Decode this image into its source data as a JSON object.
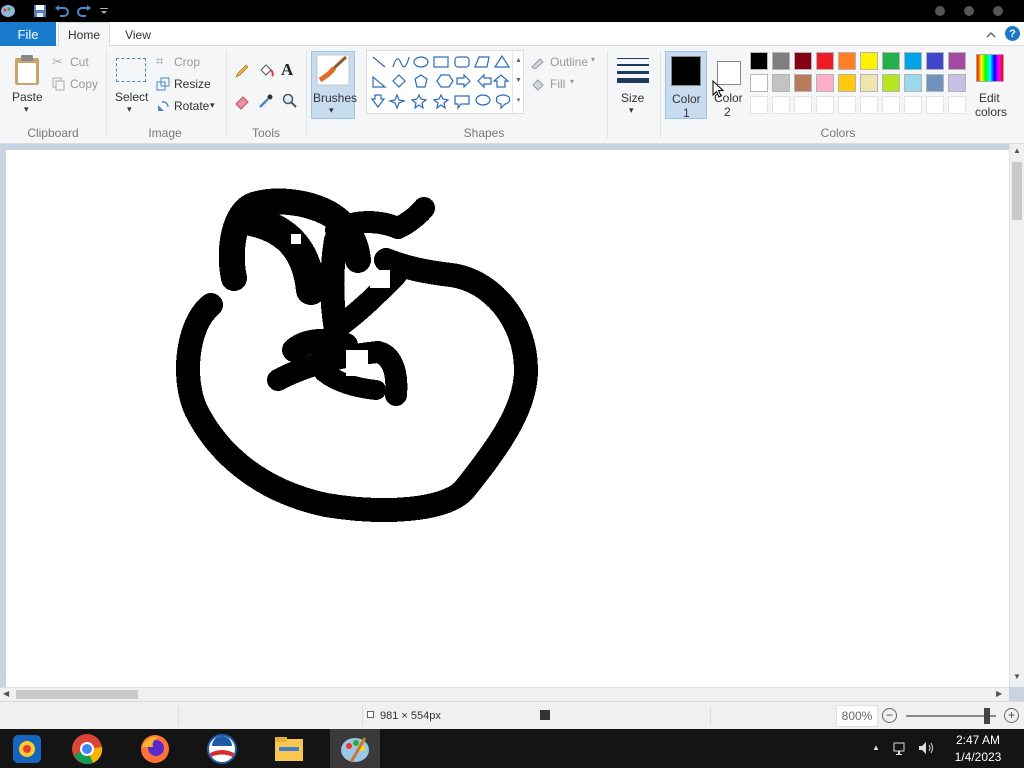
{
  "tabs": {
    "file": "File",
    "home": "Home",
    "view": "View"
  },
  "clipboard": {
    "paste": "Paste",
    "cut": "Cut",
    "copy": "Copy",
    "group": "Clipboard"
  },
  "image": {
    "select": "Select",
    "crop": "Crop",
    "resize": "Resize",
    "rotate": "Rotate",
    "group": "Image"
  },
  "tools": {
    "group": "Tools",
    "text_glyph": "A"
  },
  "brushes": {
    "label": "Brushes"
  },
  "shapes": {
    "group": "Shapes",
    "outline": "Outline",
    "fill": "Fill"
  },
  "size": {
    "label": "Size"
  },
  "colors": {
    "color1_line1": "Color",
    "color1_line2": "1",
    "color2_line1": "Color",
    "color2_line2": "2",
    "edit_line1": "Edit",
    "edit_line2": "colors",
    "group": "Colors",
    "color1_value": "#000000",
    "color2_value": "#ffffff",
    "palette_row1": [
      "#000000",
      "#7f7f7f",
      "#880015",
      "#ed1c24",
      "#ff7f27",
      "#fff200",
      "#22b14c",
      "#00a2e8",
      "#3f48cc",
      "#a349a4"
    ],
    "palette_row2": [
      "#ffffff",
      "#c3c3c3",
      "#b97a57",
      "#ffaec9",
      "#ffc90e",
      "#efe4b0",
      "#b5e61d",
      "#99d9ea",
      "#7092be",
      "#c8bfe7"
    ]
  },
  "status": {
    "dimensions": "981 × 554px",
    "zoom": "800%"
  },
  "clock": {
    "time": "2:47 AM",
    "date": "1/4/2023"
  }
}
